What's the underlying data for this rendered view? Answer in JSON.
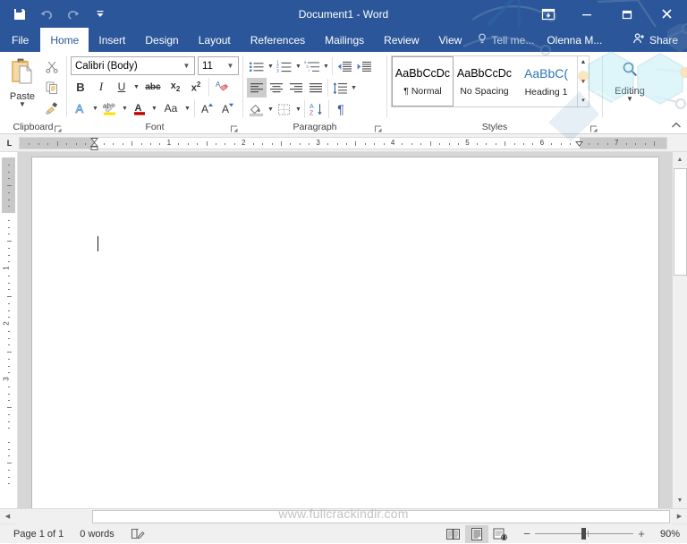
{
  "window": {
    "title": "Document1 - Word",
    "quick_access": [
      {
        "name": "save",
        "icon": "save-icon"
      },
      {
        "name": "undo",
        "icon": "undo-icon"
      },
      {
        "name": "redo",
        "icon": "redo-icon"
      },
      {
        "name": "customize-quick-access-toolbar",
        "icon": "chevron-down-icon"
      }
    ],
    "controls": [
      {
        "name": "ribbon-display-options",
        "icon": "ribbon-display-icon"
      },
      {
        "name": "minimize",
        "icon": "minimize-icon"
      },
      {
        "name": "restore",
        "icon": "restore-icon"
      },
      {
        "name": "close",
        "icon": "close-icon"
      }
    ]
  },
  "tabs": [
    {
      "label": "File",
      "active": false
    },
    {
      "label": "Home",
      "active": true
    },
    {
      "label": "Insert",
      "active": false
    },
    {
      "label": "Design",
      "active": false
    },
    {
      "label": "Layout",
      "active": false
    },
    {
      "label": "References",
      "active": false
    },
    {
      "label": "Mailings",
      "active": false
    },
    {
      "label": "Review",
      "active": false
    },
    {
      "label": "View",
      "active": false
    }
  ],
  "tellme": {
    "label": "Tell me...",
    "icon": "lightbulb-icon"
  },
  "account": {
    "label": "Olenna M..."
  },
  "share": {
    "label": "Share",
    "icon": "share-person-icon"
  },
  "ribbon": {
    "groups": [
      {
        "name": "Clipboard",
        "label": "Clipboard",
        "has_dialog_launcher": true,
        "buttons": [
          {
            "name": "paste",
            "label": "Paste",
            "icon": "paste-icon",
            "has_caret": true
          },
          {
            "name": "cut",
            "label": "Cut",
            "icon": "scissors-icon"
          },
          {
            "name": "copy",
            "label": "Copy",
            "icon": "copy-icon"
          },
          {
            "name": "format-painter",
            "label": "Format Painter",
            "icon": "paintbrush-icon"
          }
        ]
      },
      {
        "name": "Font",
        "label": "Font",
        "has_dialog_launcher": true,
        "font_name": {
          "value": "Calibri (Body)",
          "name": "font-name-combo"
        },
        "font_size": {
          "value": "11",
          "name": "font-size-combo"
        },
        "buttons": [
          {
            "name": "bold",
            "label": "B",
            "icon": "bold-icon"
          },
          {
            "name": "italic",
            "label": "I",
            "icon": "italic-icon"
          },
          {
            "name": "underline",
            "label": "U",
            "icon": "underline-icon"
          },
          {
            "name": "strikethrough",
            "label": "abc",
            "icon": "strikethrough-icon"
          },
          {
            "name": "subscript",
            "label": "x",
            "icon": "subscript-icon"
          },
          {
            "name": "superscript",
            "label": "x",
            "icon": "superscript-icon"
          },
          {
            "name": "clear-formatting",
            "label": "",
            "icon": "clear-formatting-icon"
          },
          {
            "name": "text-effects",
            "label": "A",
            "icon": "text-effects-icon"
          },
          {
            "name": "text-highlight-color",
            "label": "ab",
            "icon": "highlight-icon"
          },
          {
            "name": "font-color",
            "label": "A",
            "icon": "font-color-icon"
          },
          {
            "name": "change-case",
            "label": "Aa",
            "icon": "change-case-icon"
          },
          {
            "name": "grow-font",
            "label": "A",
            "icon": "grow-font-icon"
          },
          {
            "name": "shrink-font",
            "label": "A",
            "icon": "shrink-font-icon"
          }
        ]
      },
      {
        "name": "Paragraph",
        "label": "Paragraph",
        "has_dialog_launcher": true,
        "buttons": [
          {
            "name": "bullets",
            "icon": "bullets-icon"
          },
          {
            "name": "numbering",
            "icon": "numbering-icon"
          },
          {
            "name": "multilevel-list",
            "icon": "multilevel-list-icon"
          },
          {
            "name": "decrease-indent",
            "icon": "decrease-indent-icon"
          },
          {
            "name": "increase-indent",
            "icon": "increase-indent-icon"
          },
          {
            "name": "align-left",
            "icon": "align-left-icon",
            "selected": true
          },
          {
            "name": "align-center",
            "icon": "align-center-icon"
          },
          {
            "name": "align-right",
            "icon": "align-right-icon"
          },
          {
            "name": "justify",
            "icon": "justify-icon"
          },
          {
            "name": "line-and-paragraph-spacing",
            "icon": "line-spacing-icon"
          },
          {
            "name": "shading",
            "icon": "shading-icon"
          },
          {
            "name": "borders",
            "icon": "borders-icon"
          },
          {
            "name": "sort",
            "icon": "sort-az-icon"
          },
          {
            "name": "show-formatting-marks",
            "icon": "pilcrow-icon"
          }
        ]
      },
      {
        "name": "Styles",
        "label": "Styles",
        "has_dialog_launcher": true,
        "gallery": [
          {
            "preview": "AaBbCcDc",
            "name": "¶ Normal",
            "active": true
          },
          {
            "preview": "AaBbCcDc",
            "name": "No Spacing",
            "active": false
          },
          {
            "preview": "AaBbC(",
            "name": "Heading 1",
            "active": false,
            "heading": true
          }
        ]
      },
      {
        "name": "Editing",
        "label": "",
        "has_dialog_launcher": false,
        "buttons": [
          {
            "name": "editing",
            "label": "Editing",
            "icon": "magnifier-icon",
            "has_caret": true
          }
        ]
      }
    ],
    "collapse_ribbon": {
      "name": "collapse-ribbon",
      "icon": "chevron-up-icon"
    }
  },
  "ruler": {
    "tab_stop_selector": "L",
    "horizontal_numbers": [
      "1",
      "2",
      "3",
      "4",
      "5",
      "6",
      "7"
    ],
    "vertical_numbers": [
      "1",
      "2",
      "3"
    ]
  },
  "document": {
    "page_count": 1,
    "content": ""
  },
  "statusbar": {
    "page_label": "Page 1 of 1",
    "word_count": "0 words",
    "proofing_icon": "proofing-icon",
    "views": [
      {
        "name": "read-mode",
        "icon": "read-mode-icon",
        "selected": false
      },
      {
        "name": "print-layout",
        "icon": "print-layout-icon",
        "selected": true
      },
      {
        "name": "web-layout",
        "icon": "web-layout-icon",
        "selected": false
      }
    ],
    "zoom": {
      "out_label": "−",
      "in_label": "+",
      "percent": "90%",
      "value": 90
    }
  },
  "watermark": {
    "text": "www.fullcrackindir.com"
  },
  "colors": {
    "title_bar": "#2b579a",
    "accent": "#2b579a",
    "ribbon_bg": "#ffffff",
    "doc_bg": "#d6d6d6",
    "status_bg": "#f0f0f0",
    "heading_blue": "#2e74b5",
    "decor_teal": "#9fe3ef"
  }
}
